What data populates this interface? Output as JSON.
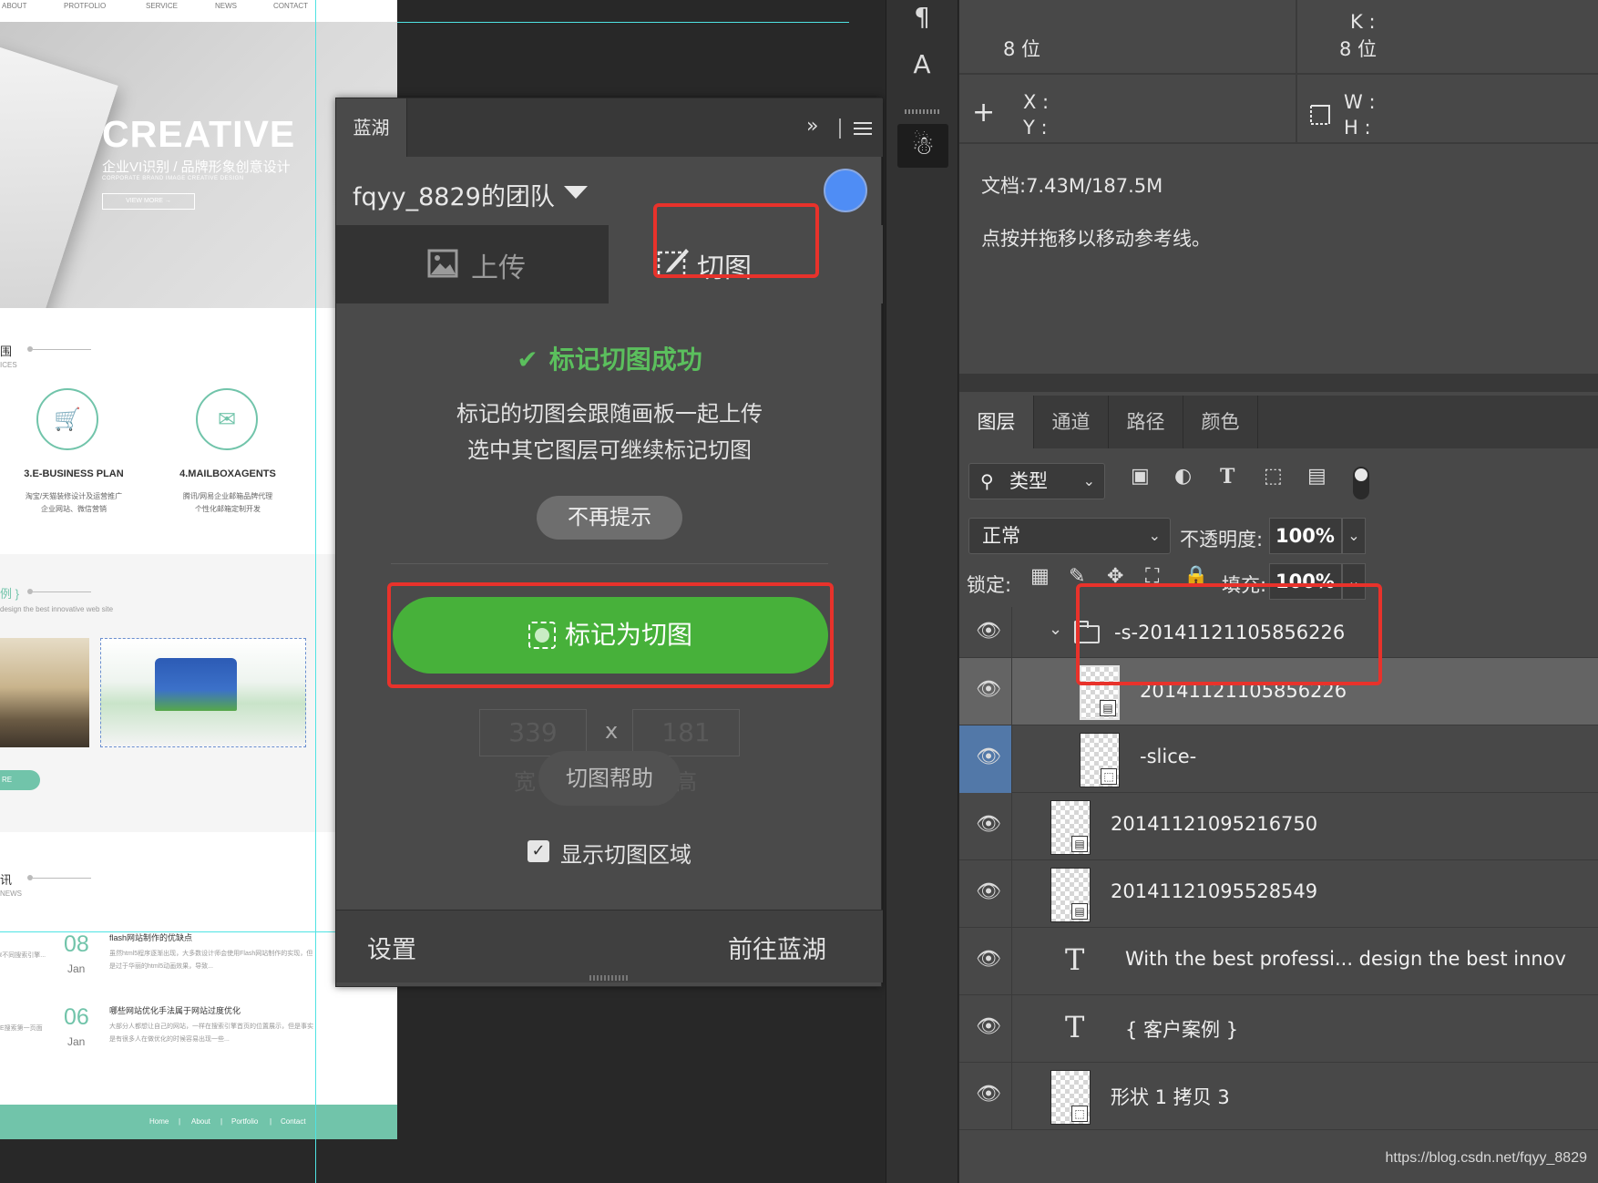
{
  "canvas": {
    "nav": [
      "ABOUT",
      "PROTFOLIO",
      "SERVICE",
      "NEWS",
      "CONTACT"
    ],
    "hero": {
      "title": "CREATIVE",
      "subtitle": "企业VI识别 / 品牌形象创意设计",
      "tagline": "CORPORATE BRAND IMAGE CREATIVE DESIGN",
      "button": "VIEW MORE →"
    },
    "services": {
      "title": "围",
      "subtitle": "ICES",
      "items": [
        {
          "icon": "cart-icon",
          "name": "3.E-BUSINESS PLAN",
          "desc1": "淘宝/天猫装修设计及运营推广",
          "desc2": "企业网站、微信营销"
        },
        {
          "icon": "mail-icon",
          "name": "4.MAILBOXAGENTS",
          "desc1": "腾讯/网易企业邮箱品牌代理",
          "desc2": "个性化邮箱定制开发"
        }
      ]
    },
    "cases": {
      "title": "例 }",
      "subtitle": "design the best innovative web site",
      "more": "RE"
    },
    "news": {
      "title": "讯",
      "subtitle": "NEWS",
      "items": [
        {
          "day": "08",
          "month": "Jan",
          "headline": "flash网站制作的优缺点",
          "text": "虽然html5程序逐渐出现，大多数设计师会使用Flash网站制作的实现，但是过于华丽的html5动画效果，导致...",
          "left": "ℓ不同搜索引擎..."
        },
        {
          "day": "06",
          "month": "Jan",
          "headline": "哪些网站优化手法属于网站过度优化",
          "text": "大部分人都想让自己的网站，一样在搜索引擎首页的位置展示，但是事实是有很多人在做优化的时候容易出现一些...",
          "left": "E搜索第一页面"
        }
      ]
    },
    "footer": [
      "Home",
      "|",
      "About",
      "|",
      "Portfolio",
      "|",
      "Contact"
    ]
  },
  "plugin": {
    "tab": "蓝湖",
    "expand_icon": "»",
    "team": "fqyy_8829的团队",
    "avatar_color": "#4f8df5",
    "tabs": {
      "upload": "上传",
      "slice": "切图"
    },
    "success": "标记切图成功",
    "line1": "标记的切图会跟随画板一起上传",
    "line2": "选中其它图层可继续标记切图",
    "dismiss": "不再提示",
    "mark_button": "标记为切图",
    "width_value": "339",
    "times": "x",
    "height_value": "181",
    "width_label": "宽",
    "height_label": "高",
    "help": "切图帮助",
    "show_slice_area": "显示切图区域",
    "settings": "设置",
    "goto": "前往蓝湖",
    "accent_color": "#47b13a",
    "highlight_color": "#e8322b"
  },
  "info": {
    "bit_left": "8 位",
    "k_label": "K :",
    "bit_right": "8 位",
    "x_label": "X :",
    "y_label": "Y :",
    "w_label": "W :",
    "h_label": "H :",
    "doc": "文档:7.43M/187.5M",
    "hint": "点按并拖移以移动参考线。"
  },
  "layers": {
    "tabs": [
      "图层",
      "通道",
      "路径",
      "颜色"
    ],
    "filter": "类型",
    "blend_mode": "正常",
    "opacity_label": "不透明度:",
    "opacity": "100%",
    "lock_label": "锁定:",
    "fill_label": "填充:",
    "fill": "100%",
    "rows": [
      {
        "name": "-s-20141121105856226",
        "kind": "group"
      },
      {
        "name": "20141121105856226",
        "kind": "smart"
      },
      {
        "name": "-slice-",
        "kind": "slice"
      },
      {
        "name": "20141121095216750",
        "kind": "smart"
      },
      {
        "name": "20141121095528549",
        "kind": "smart"
      },
      {
        "name": "With the best professi... design the best innov",
        "kind": "text"
      },
      {
        "name": "{ 客户案例 }",
        "kind": "text"
      },
      {
        "name": "形状 1 拷贝 3",
        "kind": "shape"
      }
    ]
  },
  "watermark": "https://blog.csdn.net/fqyy_8829"
}
